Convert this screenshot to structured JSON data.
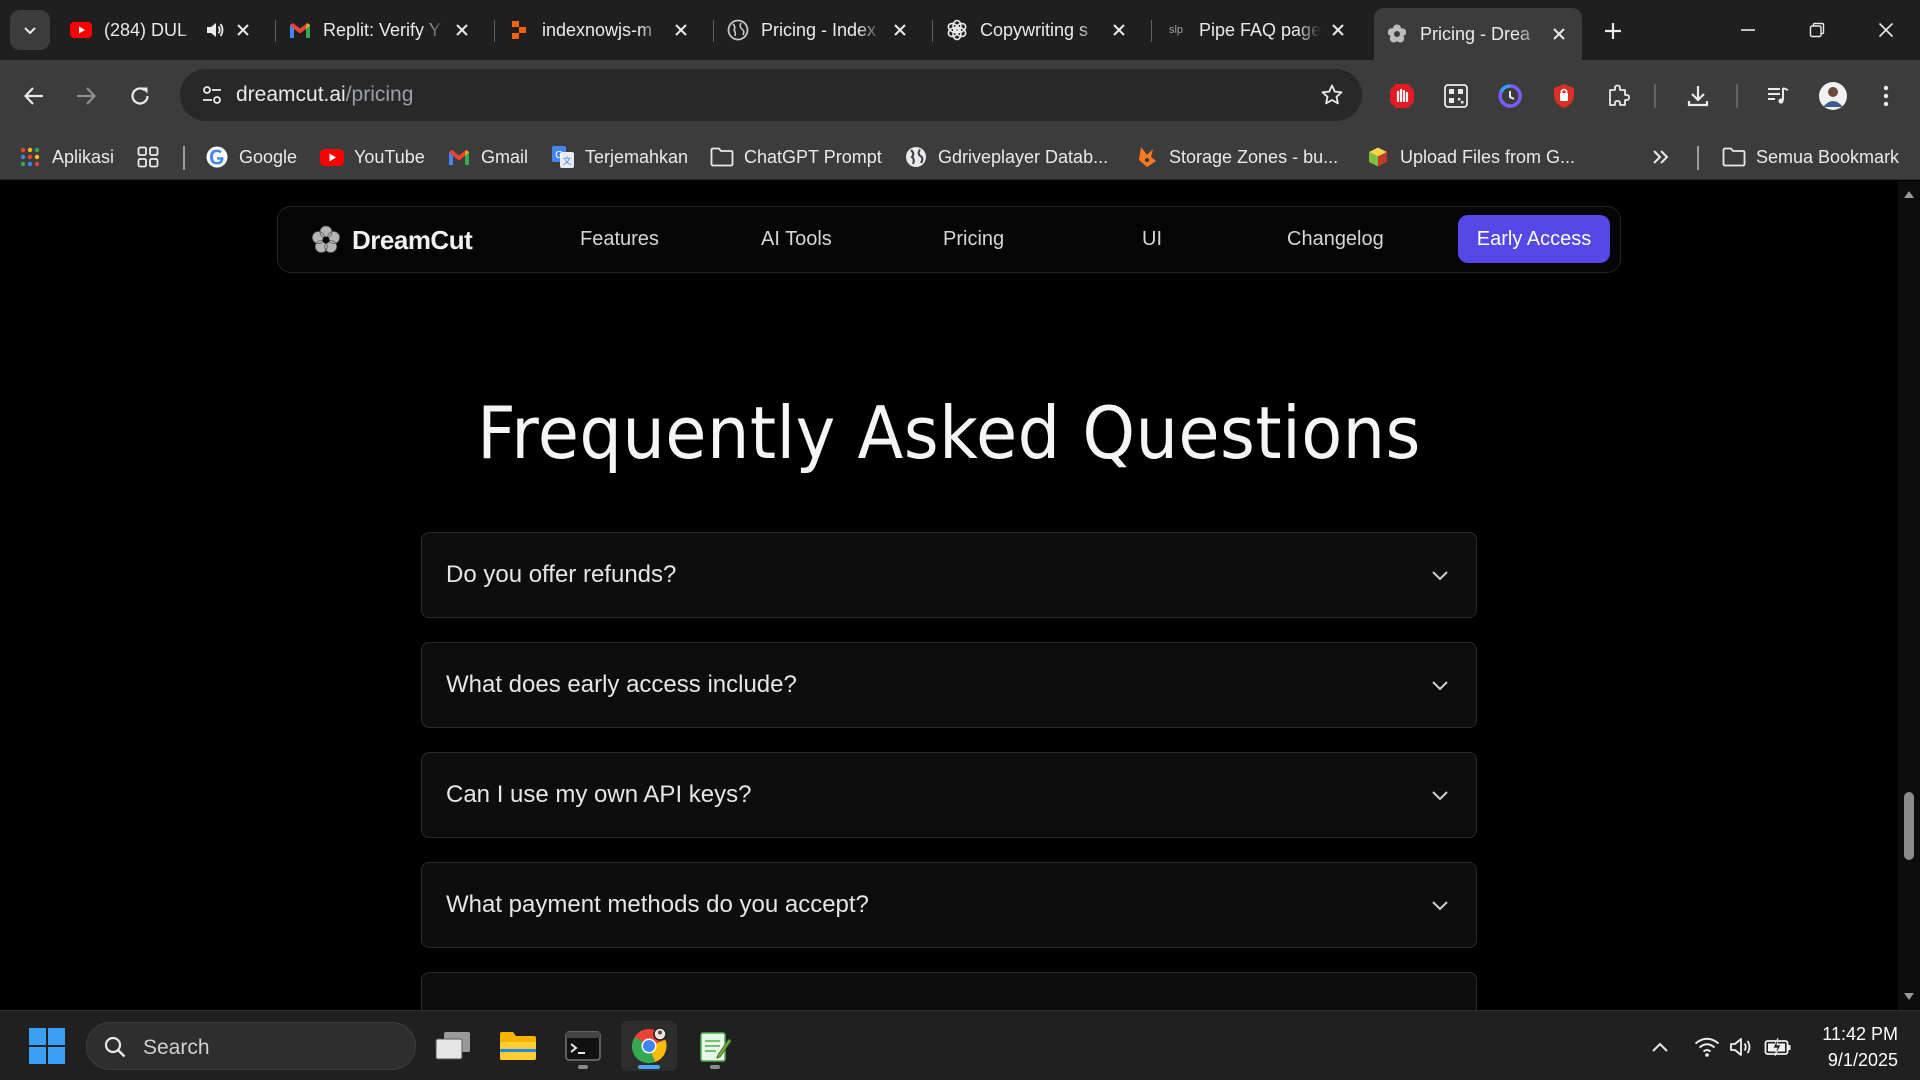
{
  "browser": {
    "tabs": [
      {
        "title": "(284) DUL",
        "favicon": "youtube-icon",
        "audio": true
      },
      {
        "title": "Replit: Verify Y",
        "favicon": "gmail-icon"
      },
      {
        "title": "indexnowjs-m",
        "favicon": "replit-icon"
      },
      {
        "title": "Pricing - Index",
        "favicon": "globe-icon"
      },
      {
        "title": "Copywriting s",
        "favicon": "chatgpt-icon"
      },
      {
        "title": "Pipe FAQ page",
        "favicon": "slp-icon",
        "favicon_text": "slp"
      },
      {
        "title": "Pricing - Drea",
        "favicon": "dreamcut-icon",
        "active": true
      }
    ],
    "url_host": "dreamcut.ai",
    "url_path": "/pricing",
    "bookmarks": [
      {
        "label": "Aplikasi",
        "icon": "apps-grid-icon"
      },
      {
        "label": "",
        "icon": "tab-groups-icon"
      },
      {
        "label": "Google",
        "icon": "google-icon"
      },
      {
        "label": "YouTube",
        "icon": "youtube-icon"
      },
      {
        "label": "Gmail",
        "icon": "gmail-icon"
      },
      {
        "label": "Terjemahkan",
        "icon": "translate-icon"
      },
      {
        "label": "ChatGPT Prompt",
        "icon": "folder-icon"
      },
      {
        "label": "Gdriveplayer Datab...",
        "icon": "globe-icon"
      },
      {
        "label": "Storage Zones - bu...",
        "icon": "bunny-icon"
      },
      {
        "label": "Upload Files from G...",
        "icon": "cube-icon"
      }
    ],
    "bookmarks_all": "Semua Bookmark",
    "colors": {
      "active_tab": "#3c3c3c",
      "tabstrip": "#1f1f1f",
      "omnibox": "#282828"
    }
  },
  "site": {
    "brand": "DreamCut",
    "nav": [
      "Features",
      "AI Tools",
      "Pricing",
      "UI",
      "Changelog"
    ],
    "cta": "Early Access",
    "accent": "#5548e6"
  },
  "faq": {
    "title": "Frequently Asked Questions",
    "items": [
      "Do you offer refunds?",
      "What does early access include?",
      "Can I use my own API keys?",
      "What payment methods do you accept?"
    ]
  },
  "taskbar": {
    "search_placeholder": "Search",
    "time": "11:42 PM",
    "date": "9/1/2025"
  }
}
